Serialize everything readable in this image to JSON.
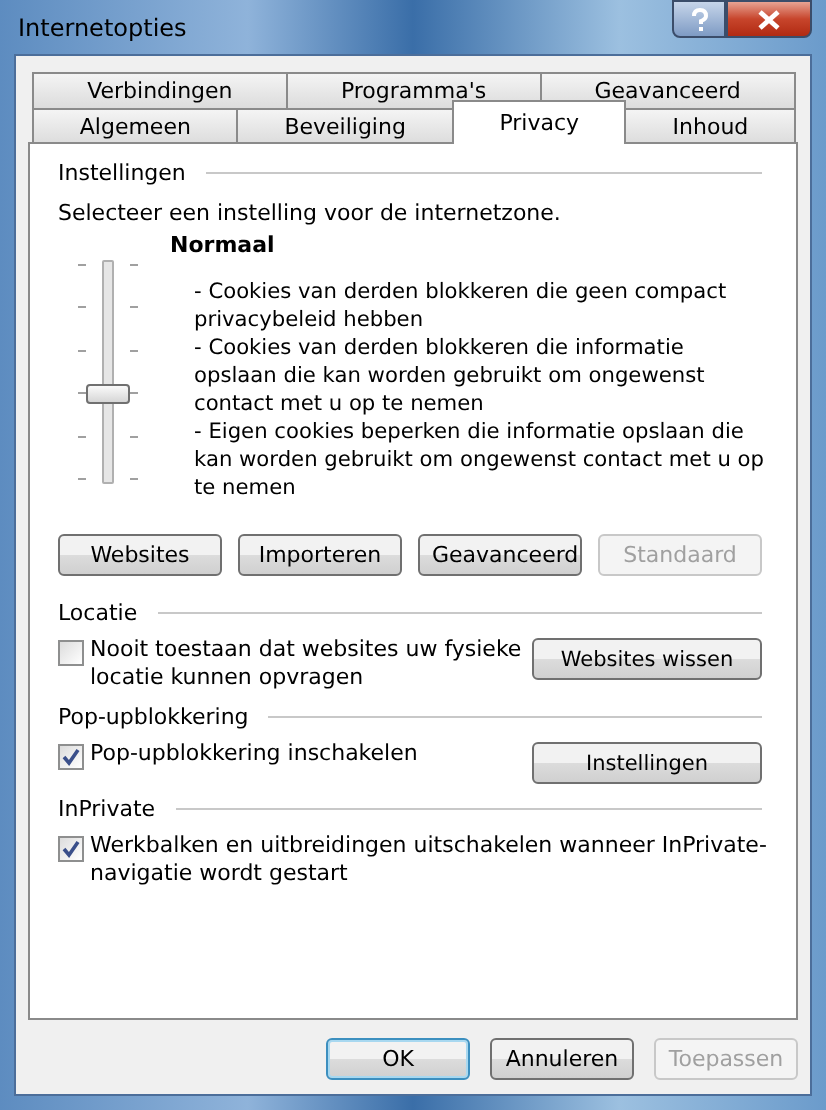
{
  "window": {
    "title": "Internetopties"
  },
  "tab_rows": [
    [
      {
        "label": "Verbindingen",
        "selected": false
      },
      {
        "label": "Programma's",
        "selected": false
      },
      {
        "label": "Geavanceerd",
        "selected": false
      }
    ],
    [
      {
        "label": "Algemeen",
        "selected": false
      },
      {
        "label": "Beveiliging",
        "selected": false
      },
      {
        "label": "Privacy",
        "selected": true
      },
      {
        "label": "Inhoud",
        "selected": false
      }
    ]
  ],
  "settings": {
    "heading": "Instellingen",
    "description": "Selecteer een instelling voor de internetzone.",
    "slider": {
      "level": 0.4
    },
    "level_name": "Normaal",
    "details": [
      "- Cookies van derden blokkeren die geen compact privacybeleid hebben",
      "- Cookies van derden blokkeren die informatie opslaan die kan worden gebruikt om ongewenst contact met u op te nemen",
      "- Eigen cookies beperken die informatie opslaan die kan worden gebruikt om ongewenst contact met u op te nemen"
    ],
    "buttons": [
      {
        "label": "Websites",
        "disabled": false
      },
      {
        "label": "Importeren",
        "disabled": false
      },
      {
        "label": "Geavanceerd",
        "disabled": false
      },
      {
        "label": "Standaard",
        "disabled": true
      }
    ]
  },
  "groups": [
    {
      "heading": "Locatie",
      "checkbox": {
        "label": "Nooit toestaan dat websites uw fysieke locatie kunnen opvragen",
        "checked": false
      },
      "button": "Websites wissen"
    },
    {
      "heading": "Pop-upblokkering",
      "checkbox": {
        "label": "Pop-upblokkering inschakelen",
        "checked": true
      },
      "button": "Instellingen"
    },
    {
      "heading": "InPrivate",
      "checkbox": {
        "label": "Werkbalken en uitbreidingen uitschakelen wanneer InPrivate-navigatie wordt gestart",
        "checked": true
      }
    }
  ],
  "footer_buttons": [
    {
      "label": "OK",
      "disabled": false,
      "default": true
    },
    {
      "label": "Annuleren",
      "disabled": false,
      "default": false
    },
    {
      "label": "Toepassen",
      "disabled": true,
      "default": false
    }
  ]
}
